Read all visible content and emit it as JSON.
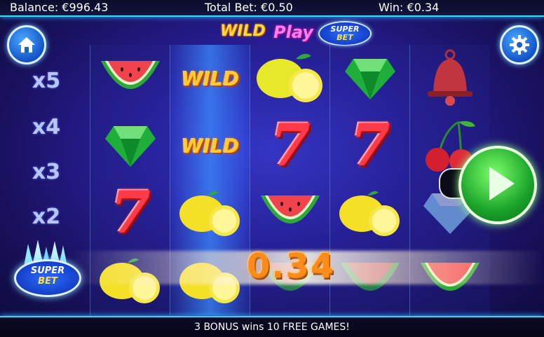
{
  "status": {
    "balance": "Balance: €996.43",
    "total_bet": "Total Bet: €0.50",
    "win": "Win: €0.34"
  },
  "logo": {
    "wild": "WILD",
    "play": "Play",
    "badge_super": "SUPER",
    "badge_bet": "BET"
  },
  "multipliers": [
    "x5",
    "x4",
    "x3",
    "x2"
  ],
  "side_badge": {
    "super": "SUPER",
    "bet": "BET"
  },
  "reels": {
    "reel1": [
      "watermelon",
      "emerald",
      "seven",
      "lemon"
    ],
    "reel2": [
      "wild",
      "wild",
      "lemon",
      "lemon"
    ],
    "reel3": [
      "lemon",
      "seven",
      "watermelon",
      "watermelon"
    ],
    "reel4": [
      "emerald",
      "seven",
      "lemon",
      "watermelon"
    ],
    "reel5": [
      "bell",
      "cherry",
      "diamond",
      "watermelon"
    ]
  },
  "symbols": {
    "wild_label": "WILD",
    "seven_label": "7"
  },
  "win_amount": "0.34",
  "message": "3 BONUS wins 10 FREE GAMES!",
  "colors": {
    "accent_line": "#3ad6ff",
    "win_orange": "#ff8c1a",
    "spin_green": "#1aa32a"
  },
  "icons": {
    "home": "home-icon",
    "settings": "gear-icon",
    "spin": "play-icon"
  }
}
